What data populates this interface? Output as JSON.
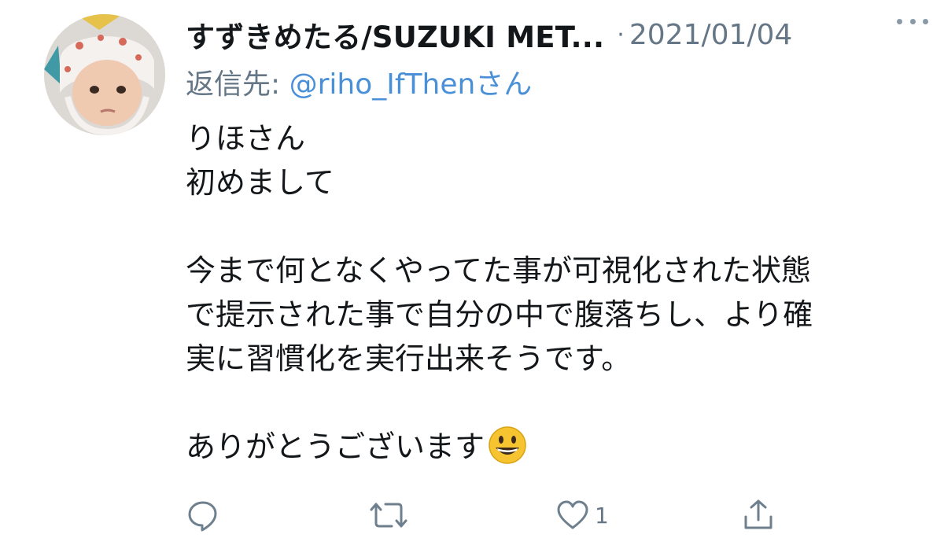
{
  "tweet": {
    "display_name": "すずきめたる/SUZUKI MET...",
    "separator": "·",
    "date": "2021/01/04",
    "reply_prefix": "返信先: ",
    "reply_handle": "@riho_IfThen",
    "reply_suffix": "さん",
    "body_lines": [
      "りほさん",
      "初めまして",
      "",
      "今まで何となくやってた事が可視化された状態",
      "で提示された事で自分の中で腹落ちし、より確",
      "実に習慣化を実行出来そうです。",
      "",
      "ありがとうございます"
    ],
    "body_emoji": "grinning-face-emoji"
  },
  "actions": {
    "reply_icon": "reply-icon",
    "retweet_icon": "retweet-icon",
    "like_icon": "heart-icon",
    "like_count": "1",
    "share_icon": "share-icon"
  },
  "colors": {
    "text": "#14171a",
    "secondary": "#657786",
    "link": "#4a90d9",
    "icon": "#6e7f8d"
  }
}
